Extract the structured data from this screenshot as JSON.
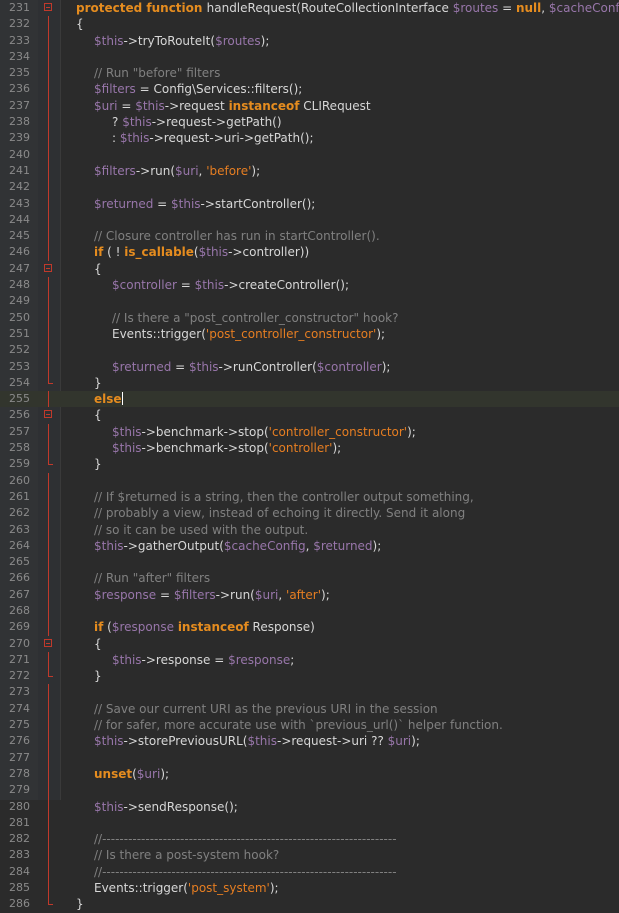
{
  "editor": {
    "theme_colors": {
      "background": "#2b2b2b",
      "gutter": "#313335",
      "keyword": "#e58c1f",
      "variable": "#9876aa",
      "string": "#e67e22",
      "comment": "#808080",
      "text": "#d7d7d7",
      "fold_marker": "#c0392b"
    },
    "caret_line": 255,
    "lines": [
      {
        "n": "231",
        "fold": "open",
        "indent": 0,
        "tokens": [
          [
            "kw",
            "protected function "
          ],
          [
            "pl",
            "handleRequest(RouteCollectionInterface "
          ],
          [
            "var",
            "$routes"
          ],
          [
            "pl",
            " = "
          ],
          [
            "kw",
            "null"
          ],
          [
            "pl",
            ", "
          ],
          [
            "var",
            "$cacheConfig"
          ],
          [
            "pl",
            ")"
          ]
        ]
      },
      {
        "n": "232",
        "fold": "guide",
        "indent": 0,
        "tokens": [
          [
            "pl",
            "{"
          ]
        ]
      },
      {
        "n": "233",
        "fold": "guide",
        "indent": 1,
        "tokens": [
          [
            "var",
            "$this"
          ],
          [
            "pl",
            "->tryToRouteIt("
          ],
          [
            "var",
            "$routes"
          ],
          [
            "pl",
            ");"
          ]
        ]
      },
      {
        "n": "234",
        "fold": "guide",
        "indent": 0,
        "tokens": []
      },
      {
        "n": "235",
        "fold": "guide",
        "indent": 1,
        "tokens": [
          [
            "cm",
            "// Run \"before\" filters"
          ]
        ]
      },
      {
        "n": "236",
        "fold": "guide",
        "indent": 1,
        "tokens": [
          [
            "var",
            "$filters"
          ],
          [
            "pl",
            " = Config\\Services::filters();"
          ]
        ]
      },
      {
        "n": "237",
        "fold": "guide",
        "indent": 1,
        "tokens": [
          [
            "var",
            "$uri"
          ],
          [
            "pl",
            " = "
          ],
          [
            "var",
            "$this"
          ],
          [
            "pl",
            "->request "
          ],
          [
            "kw",
            "instanceof"
          ],
          [
            "pl",
            " CLIRequest"
          ]
        ]
      },
      {
        "n": "238",
        "fold": "guide",
        "indent": 2,
        "tokens": [
          [
            "pl",
            "? "
          ],
          [
            "var",
            "$this"
          ],
          [
            "pl",
            "->request->getPath()"
          ]
        ]
      },
      {
        "n": "239",
        "fold": "guide",
        "indent": 2,
        "tokens": [
          [
            "pl",
            ": "
          ],
          [
            "var",
            "$this"
          ],
          [
            "pl",
            "->request->uri->getPath();"
          ]
        ]
      },
      {
        "n": "240",
        "fold": "guide",
        "indent": 0,
        "tokens": []
      },
      {
        "n": "241",
        "fold": "guide",
        "indent": 1,
        "tokens": [
          [
            "var",
            "$filters"
          ],
          [
            "pl",
            "->run("
          ],
          [
            "var",
            "$uri"
          ],
          [
            "pl",
            ", "
          ],
          [
            "str",
            "'before'"
          ],
          [
            "pl",
            ");"
          ]
        ]
      },
      {
        "n": "242",
        "fold": "guide",
        "indent": 0,
        "tokens": []
      },
      {
        "n": "243",
        "fold": "guide",
        "indent": 1,
        "tokens": [
          [
            "var",
            "$returned"
          ],
          [
            "pl",
            " = "
          ],
          [
            "var",
            "$this"
          ],
          [
            "pl",
            "->startController();"
          ]
        ]
      },
      {
        "n": "244",
        "fold": "guide",
        "indent": 0,
        "tokens": []
      },
      {
        "n": "245",
        "fold": "guide",
        "indent": 1,
        "tokens": [
          [
            "cm",
            "// Closure controller has run in startController()."
          ]
        ]
      },
      {
        "n": "246",
        "fold": "guide",
        "indent": 1,
        "tokens": [
          [
            "kw",
            "if"
          ],
          [
            "pl",
            " ( ! "
          ],
          [
            "kw",
            "is_callable"
          ],
          [
            "pl",
            "("
          ],
          [
            "var",
            "$this"
          ],
          [
            "pl",
            "->controller))"
          ]
        ]
      },
      {
        "n": "247",
        "fold": "open",
        "indent": 1,
        "tokens": [
          [
            "pl",
            "{"
          ]
        ]
      },
      {
        "n": "248",
        "fold": "guide",
        "indent": 2,
        "tokens": [
          [
            "var",
            "$controller"
          ],
          [
            "pl",
            " = "
          ],
          [
            "var",
            "$this"
          ],
          [
            "pl",
            "->createController();"
          ]
        ]
      },
      {
        "n": "249",
        "fold": "guide",
        "indent": 0,
        "tokens": []
      },
      {
        "n": "250",
        "fold": "guide",
        "indent": 2,
        "tokens": [
          [
            "cm",
            "// Is there a \"post_controller_constructor\" hook?"
          ]
        ]
      },
      {
        "n": "251",
        "fold": "guide",
        "indent": 2,
        "tokens": [
          [
            "pl",
            "Events::trigger("
          ],
          [
            "str",
            "'post_controller_constructor'"
          ],
          [
            "pl",
            ");"
          ]
        ]
      },
      {
        "n": "252",
        "fold": "guide",
        "indent": 0,
        "tokens": []
      },
      {
        "n": "253",
        "fold": "guide",
        "indent": 2,
        "tokens": [
          [
            "var",
            "$returned"
          ],
          [
            "pl",
            " = "
          ],
          [
            "var",
            "$this"
          ],
          [
            "pl",
            "->runController("
          ],
          [
            "var",
            "$controller"
          ],
          [
            "pl",
            ");"
          ]
        ]
      },
      {
        "n": "254",
        "fold": "end",
        "indent": 1,
        "tokens": [
          [
            "pl",
            "}"
          ]
        ]
      },
      {
        "n": "255",
        "fold": "guide",
        "indent": 1,
        "tokens": [
          [
            "kw",
            "else"
          ]
        ]
      },
      {
        "n": "256",
        "fold": "open",
        "indent": 1,
        "tokens": [
          [
            "pl",
            "{"
          ]
        ]
      },
      {
        "n": "257",
        "fold": "guide",
        "indent": 2,
        "tokens": [
          [
            "var",
            "$this"
          ],
          [
            "pl",
            "->benchmark->stop("
          ],
          [
            "str",
            "'controller_constructor'"
          ],
          [
            "pl",
            ");"
          ]
        ]
      },
      {
        "n": "258",
        "fold": "guide",
        "indent": 2,
        "tokens": [
          [
            "var",
            "$this"
          ],
          [
            "pl",
            "->benchmark->stop("
          ],
          [
            "str",
            "'controller'"
          ],
          [
            "pl",
            ");"
          ]
        ]
      },
      {
        "n": "259",
        "fold": "end",
        "indent": 1,
        "tokens": [
          [
            "pl",
            "}"
          ]
        ]
      },
      {
        "n": "260",
        "fold": "guide",
        "indent": 0,
        "tokens": []
      },
      {
        "n": "261",
        "fold": "guide",
        "indent": 1,
        "tokens": [
          [
            "cm",
            "// If $returned is a string, then the controller output something,"
          ]
        ]
      },
      {
        "n": "262",
        "fold": "guide",
        "indent": 1,
        "tokens": [
          [
            "cm",
            "// probably a view, instead of echoing it directly. Send it along"
          ]
        ]
      },
      {
        "n": "263",
        "fold": "guide",
        "indent": 1,
        "tokens": [
          [
            "cm",
            "// so it can be used with the output."
          ]
        ]
      },
      {
        "n": "264",
        "fold": "guide",
        "indent": 1,
        "tokens": [
          [
            "var",
            "$this"
          ],
          [
            "pl",
            "->gatherOutput("
          ],
          [
            "var",
            "$cacheConfig"
          ],
          [
            "pl",
            ", "
          ],
          [
            "var",
            "$returned"
          ],
          [
            "pl",
            ");"
          ]
        ]
      },
      {
        "n": "265",
        "fold": "guide",
        "indent": 0,
        "tokens": []
      },
      {
        "n": "266",
        "fold": "guide",
        "indent": 1,
        "tokens": [
          [
            "cm",
            "// Run \"after\" filters"
          ]
        ]
      },
      {
        "n": "267",
        "fold": "guide",
        "indent": 1,
        "tokens": [
          [
            "var",
            "$response"
          ],
          [
            "pl",
            " = "
          ],
          [
            "var",
            "$filters"
          ],
          [
            "pl",
            "->run("
          ],
          [
            "var",
            "$uri"
          ],
          [
            "pl",
            ", "
          ],
          [
            "str",
            "'after'"
          ],
          [
            "pl",
            ");"
          ]
        ]
      },
      {
        "n": "268",
        "fold": "guide",
        "indent": 0,
        "tokens": []
      },
      {
        "n": "269",
        "fold": "guide",
        "indent": 1,
        "tokens": [
          [
            "kw",
            "if"
          ],
          [
            "pl",
            " ("
          ],
          [
            "var",
            "$response"
          ],
          [
            "pl",
            " "
          ],
          [
            "kw",
            "instanceof"
          ],
          [
            "pl",
            " Response)"
          ]
        ]
      },
      {
        "n": "270",
        "fold": "open",
        "indent": 1,
        "tokens": [
          [
            "pl",
            "{"
          ]
        ]
      },
      {
        "n": "271",
        "fold": "guide",
        "indent": 2,
        "tokens": [
          [
            "var",
            "$this"
          ],
          [
            "pl",
            "->response = "
          ],
          [
            "var",
            "$response"
          ],
          [
            "pl",
            ";"
          ]
        ]
      },
      {
        "n": "272",
        "fold": "end",
        "indent": 1,
        "tokens": [
          [
            "pl",
            "}"
          ]
        ]
      },
      {
        "n": "273",
        "fold": "guide",
        "indent": 0,
        "tokens": []
      },
      {
        "n": "274",
        "fold": "guide",
        "indent": 1,
        "tokens": [
          [
            "cm",
            "// Save our current URI as the previous URI in the session"
          ]
        ]
      },
      {
        "n": "275",
        "fold": "guide",
        "indent": 1,
        "tokens": [
          [
            "cm",
            "// for safer, more accurate use with `previous_url()` helper function."
          ]
        ]
      },
      {
        "n": "276",
        "fold": "guide",
        "indent": 1,
        "tokens": [
          [
            "var",
            "$this"
          ],
          [
            "pl",
            "->storePreviousURL("
          ],
          [
            "var",
            "$this"
          ],
          [
            "pl",
            "->request->uri ?? "
          ],
          [
            "var",
            "$uri"
          ],
          [
            "pl",
            ");"
          ]
        ]
      },
      {
        "n": "277",
        "fold": "guide",
        "indent": 0,
        "tokens": []
      },
      {
        "n": "278",
        "fold": "guide",
        "indent": 1,
        "tokens": [
          [
            "kw",
            "unset"
          ],
          [
            "pl",
            "("
          ],
          [
            "var",
            "$uri"
          ],
          [
            "pl",
            ");"
          ]
        ]
      },
      {
        "n": "279",
        "fold": "guide",
        "indent": 0,
        "tokens": []
      },
      {
        "n": "280",
        "fold": "guide",
        "indent": 1,
        "tokens": [
          [
            "var",
            "$this"
          ],
          [
            "pl",
            "->sendResponse();"
          ]
        ]
      },
      {
        "n": "281",
        "fold": "guide",
        "indent": 0,
        "tokens": []
      },
      {
        "n": "282",
        "fold": "guide",
        "indent": 1,
        "tokens": [
          [
            "cm",
            "//--------------------------------------------------------------------"
          ]
        ]
      },
      {
        "n": "283",
        "fold": "guide",
        "indent": 1,
        "tokens": [
          [
            "cm",
            "// Is there a post-system hook?"
          ]
        ]
      },
      {
        "n": "284",
        "fold": "guide",
        "indent": 1,
        "tokens": [
          [
            "cm",
            "//--------------------------------------------------------------------"
          ]
        ]
      },
      {
        "n": "285",
        "fold": "guide",
        "indent": 1,
        "tokens": [
          [
            "pl",
            "Events::trigger("
          ],
          [
            "str",
            "'post_system'"
          ],
          [
            "pl",
            ");"
          ]
        ]
      },
      {
        "n": "286",
        "fold": "end",
        "indent": 0,
        "tokens": [
          [
            "pl",
            "}"
          ]
        ]
      }
    ]
  }
}
